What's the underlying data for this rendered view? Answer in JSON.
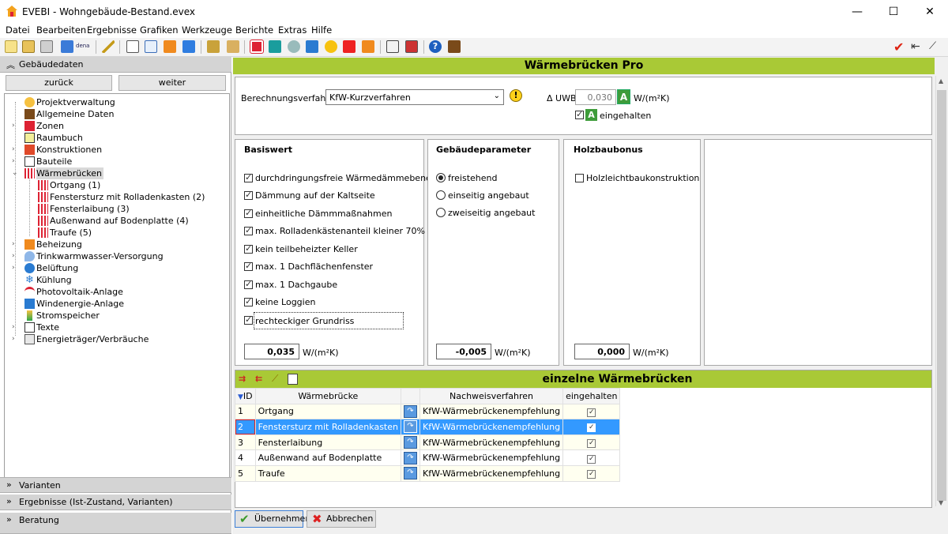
{
  "window": {
    "title": "EVEBI - Wohngebäude-Bestand.evex",
    "min": "—",
    "max": "☐",
    "close": "✕"
  },
  "menu": [
    "Datei",
    "Bearbeiten",
    "Ergebnisse",
    "Grafiken",
    "Werkzeuge",
    "Berichte",
    "Extras",
    "Hilfe"
  ],
  "left": {
    "section_top": "Gebäudedaten",
    "back": "zurück",
    "next": "weiter",
    "tree": [
      "Projektverwaltung",
      "Allgemeine Daten",
      "Zonen",
      "Raumbuch",
      "Konstruktionen",
      "Bauteile",
      "Wärmebrücken",
      "Ortgang (1)",
      "Fenstersturz mit Rolladenkasten (2)",
      "Fensterlaibung (3)",
      "Außenwand auf Bodenplatte (4)",
      "Traufe (5)",
      "Beheizung",
      "Trinkwarmwasser-Versorgung",
      "Belüftung",
      "Kühlung",
      "Photovoltaik-Anlage",
      "Windenergie-Anlage",
      "Stromspeicher",
      "Texte",
      "Energieträger/Verbräuche"
    ],
    "section_varianten": "Varianten",
    "section_ergebnisse": "Ergebnisse (Ist-Zustand, Varianten)",
    "section_beratung": "Beratung"
  },
  "main": {
    "header": "Wärmebrücken Pro",
    "berechnung_label": "Berechnungsverfahren",
    "berechnung_value": "KfW-Kurzverfahren",
    "duwb_label": "Δ UWB",
    "duwb_value": "0,030",
    "duwb_unit": "W/(m²K)",
    "eingehalten": "eingehalten",
    "grade": "A",
    "basiswert": {
      "title": "Basiswert",
      "items": [
        "durchdringungsfreie Wärmedämmebene",
        "Dämmung auf der Kaltseite",
        "einheitliche Dämmmaßnahmen",
        "max. Rolladenkästenanteil kleiner 70%",
        "kein teilbeheizter Keller",
        "max. 1 Dachflächenfenster",
        "max. 1 Dachgaube",
        "keine Loggien",
        "rechteckiger Grundriss"
      ],
      "value": "0,035",
      "unit": "W/(m²K)"
    },
    "gebaeude": {
      "title": "Gebäudeparameter",
      "options": [
        "freistehend",
        "einseitig angebaut",
        "zweiseitig angebaut"
      ],
      "value": "-0,005",
      "unit": "W/(m²K)"
    },
    "holzbau": {
      "title": "Holzbaubonus",
      "option": "Holzleichtbaukonstruktion",
      "value": "0,000",
      "unit": "W/(m²K)"
    },
    "einzelne_header": "einzelne Wärmebrücken",
    "table": {
      "headers": [
        "ID",
        "Wärmebrücke",
        "",
        "Nachweisverfahren",
        "eingehalten"
      ],
      "rows": [
        [
          "1",
          "Ortgang",
          "KfW-Wärmebrückenempfehlung"
        ],
        [
          "2",
          "Fenstersturz mit Rolladenkasten",
          "KfW-Wärmebrückenempfehlung"
        ],
        [
          "3",
          "Fensterlaibung",
          "KfW-Wärmebrückenempfehlung"
        ],
        [
          "4",
          "Außenwand auf Bodenplatte",
          "KfW-Wärmebrückenempfehlung"
        ],
        [
          "5",
          "Traufe",
          "KfW-Wärmebrückenempfehlung"
        ]
      ]
    },
    "apply": "Übernehmen",
    "cancel": "Abbrechen"
  }
}
